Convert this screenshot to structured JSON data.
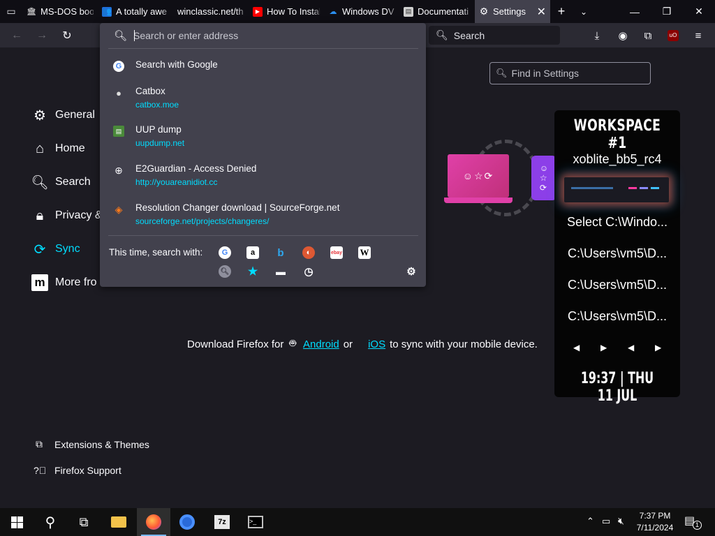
{
  "tabs": [
    {
      "title": "MS-DOS boot",
      "icon": "museum-icon"
    },
    {
      "title": "A totally awe",
      "icon": "people-icon"
    },
    {
      "title": "winclassic.net/th",
      "icon": "blank-icon"
    },
    {
      "title": "How To Instal",
      "icon": "youtube-icon"
    },
    {
      "title": "Windows DV",
      "icon": "cloud-icon"
    },
    {
      "title": "Documentati",
      "icon": "document-icon"
    },
    {
      "title": "Settings",
      "icon": "gear-icon"
    }
  ],
  "toolbar": {
    "search_label": "Search"
  },
  "urlbar": {
    "placeholder": "Search or enter address",
    "suggestions": [
      {
        "title": "Search with Google",
        "url": "",
        "icon": "google-icon"
      },
      {
        "title": "Catbox",
        "url": "catbox.moe",
        "icon": "catbox-icon"
      },
      {
        "title": "UUP dump",
        "url": "uupdump.net",
        "icon": "uupdump-icon"
      },
      {
        "title": "E2Guardian - Access Denied",
        "url": "http://youareanidiot.cc",
        "icon": "globe-icon"
      },
      {
        "title": "Resolution Changer download | SourceForge.net",
        "url": "sourceforge.net/projects/changeres/",
        "icon": "sourceforge-icon"
      }
    ],
    "oneoff_label": "This time, search with:",
    "engines": [
      "google-icon",
      "amazon-icon",
      "bing-icon",
      "duckduckgo-icon",
      "ebay-icon",
      "wikipedia-icon"
    ],
    "local_sources": [
      "search-history-icon",
      "bookmarks-icon",
      "tabs-icon",
      "history-icon"
    ]
  },
  "settings": {
    "find_placeholder": "Find in Settings",
    "categories": [
      {
        "label": "General",
        "icon": "gear-icon"
      },
      {
        "label": "Home",
        "icon": "home-icon"
      },
      {
        "label": "Search",
        "icon": "search-icon"
      },
      {
        "label": "Privacy &",
        "icon": "lock-icon"
      },
      {
        "label": "Sync",
        "icon": "sync-icon",
        "selected": true
      },
      {
        "label": "More fro",
        "icon": "mozilla-icon"
      }
    ],
    "footer": [
      {
        "label": "Extensions & Themes",
        "icon": "puzzle-icon"
      },
      {
        "label": "Firefox Support",
        "icon": "help-icon"
      }
    ],
    "mobile": {
      "prefix": "Download Firefox for",
      "android": "Android",
      "or": "or",
      "ios": "iOS",
      "suffix": "to sync with your mobile device."
    }
  },
  "workspace": {
    "title": "WORKSPACE #1",
    "name": "xoblite_bb5_rc4",
    "items": [
      "Select C:\\Windo...",
      "C:\\Users\\vm5\\D...",
      "C:\\Users\\vm5\\D...",
      "C:\\Users\\vm5\\D..."
    ],
    "clock": "19:37 | THU 11 JUL"
  },
  "taskbar": {
    "time": "7:37 PM",
    "date": "7/11/2024",
    "notification_count": "1"
  },
  "colors": {
    "accent": "#00ddff",
    "toolbar": "#2b2a33",
    "popup": "#42414d",
    "page": "#1c1b22"
  }
}
